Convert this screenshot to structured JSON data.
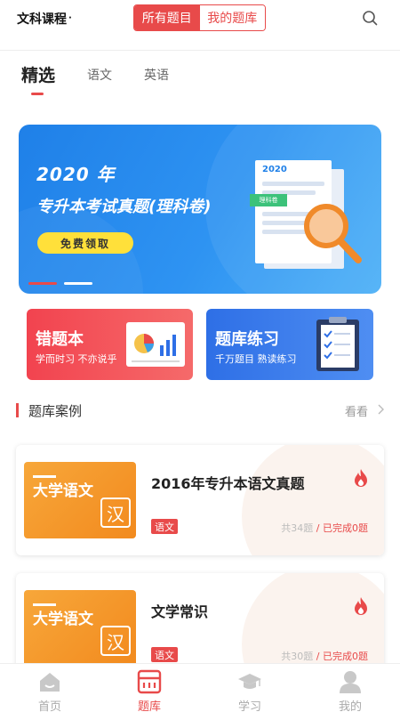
{
  "header": {
    "course_label": "文科课程",
    "course_dot": "·",
    "seg_active": "所有题目",
    "seg_inactive": "我的题库"
  },
  "tabs": [
    {
      "label": "精选",
      "active": true
    },
    {
      "label": "语文",
      "active": false
    },
    {
      "label": "英语",
      "active": false
    }
  ],
  "banner": {
    "year": "2020 年",
    "title": "专升本考试真题(理科卷)",
    "button": "免费领取",
    "doc_year": "2020",
    "doc_tag": "理科卷"
  },
  "features": [
    {
      "title": "错题本",
      "subtitle": "学而时习 不亦说乎"
    },
    {
      "title": "题库练习",
      "subtitle": "千万题目 熟读练习"
    }
  ],
  "section": {
    "title": "题库案例",
    "more": "看看"
  },
  "courses": [
    {
      "thumb_text": "大学语文",
      "thumb_char": "汉",
      "title": "2016年专升本语文真题",
      "tag": "语文",
      "total": "共34题",
      "sep": " / ",
      "done": "已完成0题"
    },
    {
      "thumb_text": "大学语文",
      "thumb_char": "汉",
      "title": "文学常识",
      "tag": "语文",
      "total": "共30题",
      "sep": " / ",
      "done": "已完成0题"
    }
  ],
  "bottom_nav": [
    {
      "label": "首页",
      "icon": "home-icon",
      "active": false
    },
    {
      "label": "题库",
      "icon": "question-bank-icon",
      "active": true
    },
    {
      "label": "学习",
      "icon": "graduation-cap-icon",
      "active": false
    },
    {
      "label": "我的",
      "icon": "user-icon",
      "active": false
    }
  ],
  "colors": {
    "accent": "#e84a4a",
    "banner_blue": "#1f80e8",
    "card_red": "#f2434f",
    "card_blue": "#2e6fe6",
    "thumb_orange": "#f7a73a"
  }
}
